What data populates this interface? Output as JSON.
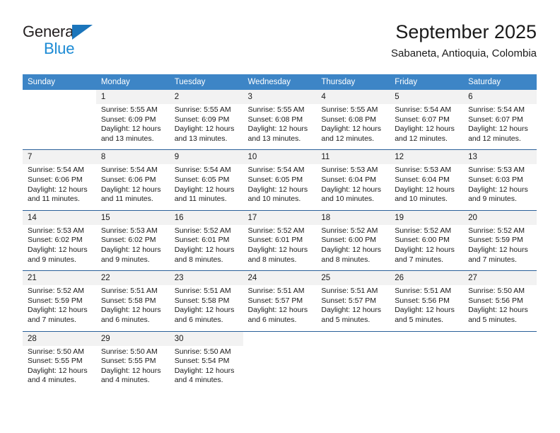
{
  "logo": {
    "word_one": "General",
    "word_two": "Blue",
    "triangle_color": "#1b75bb",
    "blue_text_color": "#1b8ad4"
  },
  "header": {
    "title": "September 2025",
    "subtitle": "Sabaneta, Antioquia, Colombia"
  },
  "theme": {
    "header_bg": "#3d85c6",
    "day_number_bg": "#f2f2f2",
    "week_divider": "#2a6099"
  },
  "calendar": {
    "weekday_headers": [
      "Sunday",
      "Monday",
      "Tuesday",
      "Wednesday",
      "Thursday",
      "Friday",
      "Saturday"
    ],
    "weeks": [
      {
        "days": [
          {
            "number": "",
            "lines": [
              "",
              "",
              "",
              ""
            ]
          },
          {
            "number": "1",
            "lines": [
              "Sunrise: 5:55 AM",
              "Sunset: 6:09 PM",
              "Daylight: 12 hours",
              "and 13 minutes."
            ]
          },
          {
            "number": "2",
            "lines": [
              "Sunrise: 5:55 AM",
              "Sunset: 6:09 PM",
              "Daylight: 12 hours",
              "and 13 minutes."
            ]
          },
          {
            "number": "3",
            "lines": [
              "Sunrise: 5:55 AM",
              "Sunset: 6:08 PM",
              "Daylight: 12 hours",
              "and 13 minutes."
            ]
          },
          {
            "number": "4",
            "lines": [
              "Sunrise: 5:55 AM",
              "Sunset: 6:08 PM",
              "Daylight: 12 hours",
              "and 12 minutes."
            ]
          },
          {
            "number": "5",
            "lines": [
              "Sunrise: 5:54 AM",
              "Sunset: 6:07 PM",
              "Daylight: 12 hours",
              "and 12 minutes."
            ]
          },
          {
            "number": "6",
            "lines": [
              "Sunrise: 5:54 AM",
              "Sunset: 6:07 PM",
              "Daylight: 12 hours",
              "and 12 minutes."
            ]
          }
        ]
      },
      {
        "days": [
          {
            "number": "7",
            "lines": [
              "Sunrise: 5:54 AM",
              "Sunset: 6:06 PM",
              "Daylight: 12 hours",
              "and 11 minutes."
            ]
          },
          {
            "number": "8",
            "lines": [
              "Sunrise: 5:54 AM",
              "Sunset: 6:06 PM",
              "Daylight: 12 hours",
              "and 11 minutes."
            ]
          },
          {
            "number": "9",
            "lines": [
              "Sunrise: 5:54 AM",
              "Sunset: 6:05 PM",
              "Daylight: 12 hours",
              "and 11 minutes."
            ]
          },
          {
            "number": "10",
            "lines": [
              "Sunrise: 5:54 AM",
              "Sunset: 6:05 PM",
              "Daylight: 12 hours",
              "and 10 minutes."
            ]
          },
          {
            "number": "11",
            "lines": [
              "Sunrise: 5:53 AM",
              "Sunset: 6:04 PM",
              "Daylight: 12 hours",
              "and 10 minutes."
            ]
          },
          {
            "number": "12",
            "lines": [
              "Sunrise: 5:53 AM",
              "Sunset: 6:04 PM",
              "Daylight: 12 hours",
              "and 10 minutes."
            ]
          },
          {
            "number": "13",
            "lines": [
              "Sunrise: 5:53 AM",
              "Sunset: 6:03 PM",
              "Daylight: 12 hours",
              "and 9 minutes."
            ]
          }
        ]
      },
      {
        "days": [
          {
            "number": "14",
            "lines": [
              "Sunrise: 5:53 AM",
              "Sunset: 6:02 PM",
              "Daylight: 12 hours",
              "and 9 minutes."
            ]
          },
          {
            "number": "15",
            "lines": [
              "Sunrise: 5:53 AM",
              "Sunset: 6:02 PM",
              "Daylight: 12 hours",
              "and 9 minutes."
            ]
          },
          {
            "number": "16",
            "lines": [
              "Sunrise: 5:52 AM",
              "Sunset: 6:01 PM",
              "Daylight: 12 hours",
              "and 8 minutes."
            ]
          },
          {
            "number": "17",
            "lines": [
              "Sunrise: 5:52 AM",
              "Sunset: 6:01 PM",
              "Daylight: 12 hours",
              "and 8 minutes."
            ]
          },
          {
            "number": "18",
            "lines": [
              "Sunrise: 5:52 AM",
              "Sunset: 6:00 PM",
              "Daylight: 12 hours",
              "and 8 minutes."
            ]
          },
          {
            "number": "19",
            "lines": [
              "Sunrise: 5:52 AM",
              "Sunset: 6:00 PM",
              "Daylight: 12 hours",
              "and 7 minutes."
            ]
          },
          {
            "number": "20",
            "lines": [
              "Sunrise: 5:52 AM",
              "Sunset: 5:59 PM",
              "Daylight: 12 hours",
              "and 7 minutes."
            ]
          }
        ]
      },
      {
        "days": [
          {
            "number": "21",
            "lines": [
              "Sunrise: 5:52 AM",
              "Sunset: 5:59 PM",
              "Daylight: 12 hours",
              "and 7 minutes."
            ]
          },
          {
            "number": "22",
            "lines": [
              "Sunrise: 5:51 AM",
              "Sunset: 5:58 PM",
              "Daylight: 12 hours",
              "and 6 minutes."
            ]
          },
          {
            "number": "23",
            "lines": [
              "Sunrise: 5:51 AM",
              "Sunset: 5:58 PM",
              "Daylight: 12 hours",
              "and 6 minutes."
            ]
          },
          {
            "number": "24",
            "lines": [
              "Sunrise: 5:51 AM",
              "Sunset: 5:57 PM",
              "Daylight: 12 hours",
              "and 6 minutes."
            ]
          },
          {
            "number": "25",
            "lines": [
              "Sunrise: 5:51 AM",
              "Sunset: 5:57 PM",
              "Daylight: 12 hours",
              "and 5 minutes."
            ]
          },
          {
            "number": "26",
            "lines": [
              "Sunrise: 5:51 AM",
              "Sunset: 5:56 PM",
              "Daylight: 12 hours",
              "and 5 minutes."
            ]
          },
          {
            "number": "27",
            "lines": [
              "Sunrise: 5:50 AM",
              "Sunset: 5:56 PM",
              "Daylight: 12 hours",
              "and 5 minutes."
            ]
          }
        ]
      },
      {
        "days": [
          {
            "number": "28",
            "lines": [
              "Sunrise: 5:50 AM",
              "Sunset: 5:55 PM",
              "Daylight: 12 hours",
              "and 4 minutes."
            ]
          },
          {
            "number": "29",
            "lines": [
              "Sunrise: 5:50 AM",
              "Sunset: 5:55 PM",
              "Daylight: 12 hours",
              "and 4 minutes."
            ]
          },
          {
            "number": "30",
            "lines": [
              "Sunrise: 5:50 AM",
              "Sunset: 5:54 PM",
              "Daylight: 12 hours",
              "and 4 minutes."
            ]
          },
          {
            "number": "",
            "lines": [
              "",
              "",
              "",
              ""
            ]
          },
          {
            "number": "",
            "lines": [
              "",
              "",
              "",
              ""
            ]
          },
          {
            "number": "",
            "lines": [
              "",
              "",
              "",
              ""
            ]
          },
          {
            "number": "",
            "lines": [
              "",
              "",
              "",
              ""
            ]
          }
        ]
      }
    ]
  }
}
